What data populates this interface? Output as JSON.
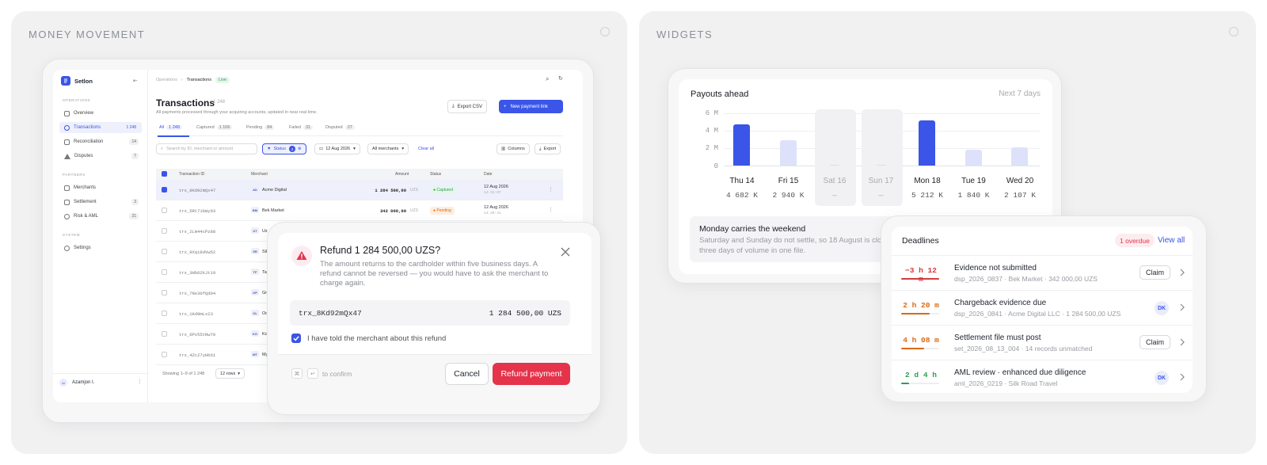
{
  "panels": {
    "left_title": "MONEY MOVEMENT",
    "right_title": "WIDGETS"
  },
  "app": {
    "brand": "Setlon",
    "sections": {
      "operations": "OPERATIONS",
      "partners": "PARTNERS",
      "system": "SYSTEM"
    },
    "nav": [
      {
        "label": "Overview",
        "count": ""
      },
      {
        "label": "Transactions",
        "count": "1 248"
      },
      {
        "label": "Reconciliation",
        "count": "14"
      },
      {
        "label": "Disputes",
        "count": "7"
      },
      {
        "label": "Merchants",
        "count": ""
      },
      {
        "label": "Settlement",
        "count": "3"
      },
      {
        "label": "Risk & AML",
        "count": "21"
      },
      {
        "label": "Settings",
        "count": ""
      }
    ],
    "user": {
      "initials": "AI",
      "name": "Azamjon I."
    },
    "breadcrumb": {
      "parent": "Operations",
      "current": "Transactions",
      "badge": "Live"
    },
    "page_title": "Transactions",
    "page_count": "1 248",
    "page_sub": "All payments processed through your acquiring accounts, updated in near real time.",
    "export_csv": "Export CSV",
    "new_link": "New payment link",
    "tabs": [
      {
        "label": "All",
        "count": "1 248"
      },
      {
        "label": "Captured",
        "count": "1 106"
      },
      {
        "label": "Pending",
        "count": "84"
      },
      {
        "label": "Failed",
        "count": "31"
      },
      {
        "label": "Disputed",
        "count": "27"
      }
    ],
    "search_placeholder": "Search by ID, merchant or amount",
    "filter_status": "Status",
    "filter_status_count": "3",
    "filter_date": "12 Aug 2026",
    "filter_merchants": "All merchants",
    "clear_all": "Clear all",
    "columns": "Columns",
    "export": "Export",
    "table_headers": {
      "id": "Transaction ID",
      "merchant": "Merchant",
      "amount": "Amount",
      "status": "Status",
      "date": "Date"
    },
    "rows": [
      {
        "id": "trx_8Kd92mQx47",
        "mb": "AD",
        "merchant": "Acme Digital",
        "amount": "1 284 500,00",
        "cur": "UZS",
        "status": "Captured",
        "date": "12 Aug 2026",
        "time": "14:32:07"
      },
      {
        "id": "trx_5Rt71bWy03",
        "mb": "BM",
        "merchant": "Bek Market",
        "amount": "342 000,00",
        "cur": "UZS",
        "status": "Pending",
        "date": "12 Aug 2026",
        "time": "14:29:41"
      },
      {
        "id": "trx_2Lm44cPz88",
        "mb": "UT",
        "merchant": "Uz"
      },
      {
        "id": "trx_9Xq18dVw52",
        "mb": "SR",
        "merchant": "Sil"
      },
      {
        "id": "trx_3Hb62kJt19",
        "mb": "TF",
        "merchant": "Ta"
      },
      {
        "id": "trx_7Ns30fQd94",
        "mb": "GP",
        "merchant": "Gr"
      },
      {
        "id": "trx_1Kd9mLx23",
        "mb": "OL",
        "merchant": "Oq"
      },
      {
        "id": "trx_6Pv55tRw70",
        "mb": "KO",
        "merchant": "Ko"
      },
      {
        "id": "trx_4Zc27yHb61",
        "mb": "MT",
        "merchant": "My"
      }
    ],
    "showing": "Showing 1–9 of 1 248",
    "rows_per_page": "12 rows"
  },
  "modal": {
    "title": "Refund 1 284 500,00 UZS?",
    "body": "The amount returns to the cardholder within five business days. A refund cannot be reversed — you would have to ask the merchant to charge again.",
    "trx_id": "trx_8Kd92mQx47",
    "amount": "1 284 500,00 UZS",
    "checkbox_label": "I have told the merchant about this refund",
    "kbd1": "⌘",
    "kbd2": "↵",
    "confirm_hint": "to confirm",
    "cancel": "Cancel",
    "refund": "Refund payment"
  },
  "payouts": {
    "title": "Payouts ahead",
    "range": "Next 7 days",
    "y_ticks": [
      "6 M",
      "4 M",
      "2 M",
      "0"
    ],
    "callout_title": "Monday carries the weekend",
    "callout_body": "Saturday and Sunday do not settle, so 18 August is close to three days of volume in one file."
  },
  "chart_data": {
    "type": "bar",
    "title": "Payouts ahead",
    "categories": [
      "Thu 14",
      "Fri 15",
      "Sat 16",
      "Sun 17",
      "Mon 18",
      "Tue 19",
      "Wed 20"
    ],
    "value_labels": [
      "4 682 K",
      "2 940 K",
      "—",
      "—",
      "5 212 K",
      "1 840 K",
      "2 107 K"
    ],
    "values": [
      4682,
      2940,
      0,
      0,
      5212,
      1840,
      2107
    ],
    "unit": "K",
    "ylim": [
      0,
      6000
    ],
    "highlight": [
      "Thu 14",
      "Mon 18"
    ],
    "non_settlement_days": [
      "Sat 16",
      "Sun 17"
    ],
    "colors": {
      "highlight": "#3a55e8",
      "normal": "#dde2fa"
    }
  },
  "deadlines": {
    "title": "Deadlines",
    "overdue": "1 overdue",
    "view_all": "View all",
    "items": [
      {
        "time": "−3 h 12 m",
        "title": "Evidence not submitted",
        "sub": "dsp_2026_0837 · Bek Market · 342 000,00 UZS",
        "action": "Claim",
        "color": "#d23b3b",
        "progress": 1.0
      },
      {
        "time": "2 h 20 m",
        "title": "Chargeback evidence due",
        "sub": "dsp_2026_0841 · Acme Digital LLC · 1 284 500,00 UZS",
        "action": "DK",
        "color": "#d96a12",
        "progress": 0.75
      },
      {
        "time": "4 h 08 m",
        "title": "Settlement file must post",
        "sub": "set_2026_08_13_004 · 14 records unmatched",
        "action": "Claim",
        "color": "#d96a12",
        "progress": 0.6
      },
      {
        "time": "2 d 4 h",
        "title": "AML review · enhanced due diligence",
        "sub": "aml_2026_0219 · Silk Road Travel",
        "action": "DK",
        "color": "#2e9e55",
        "progress": 0.2
      }
    ]
  }
}
